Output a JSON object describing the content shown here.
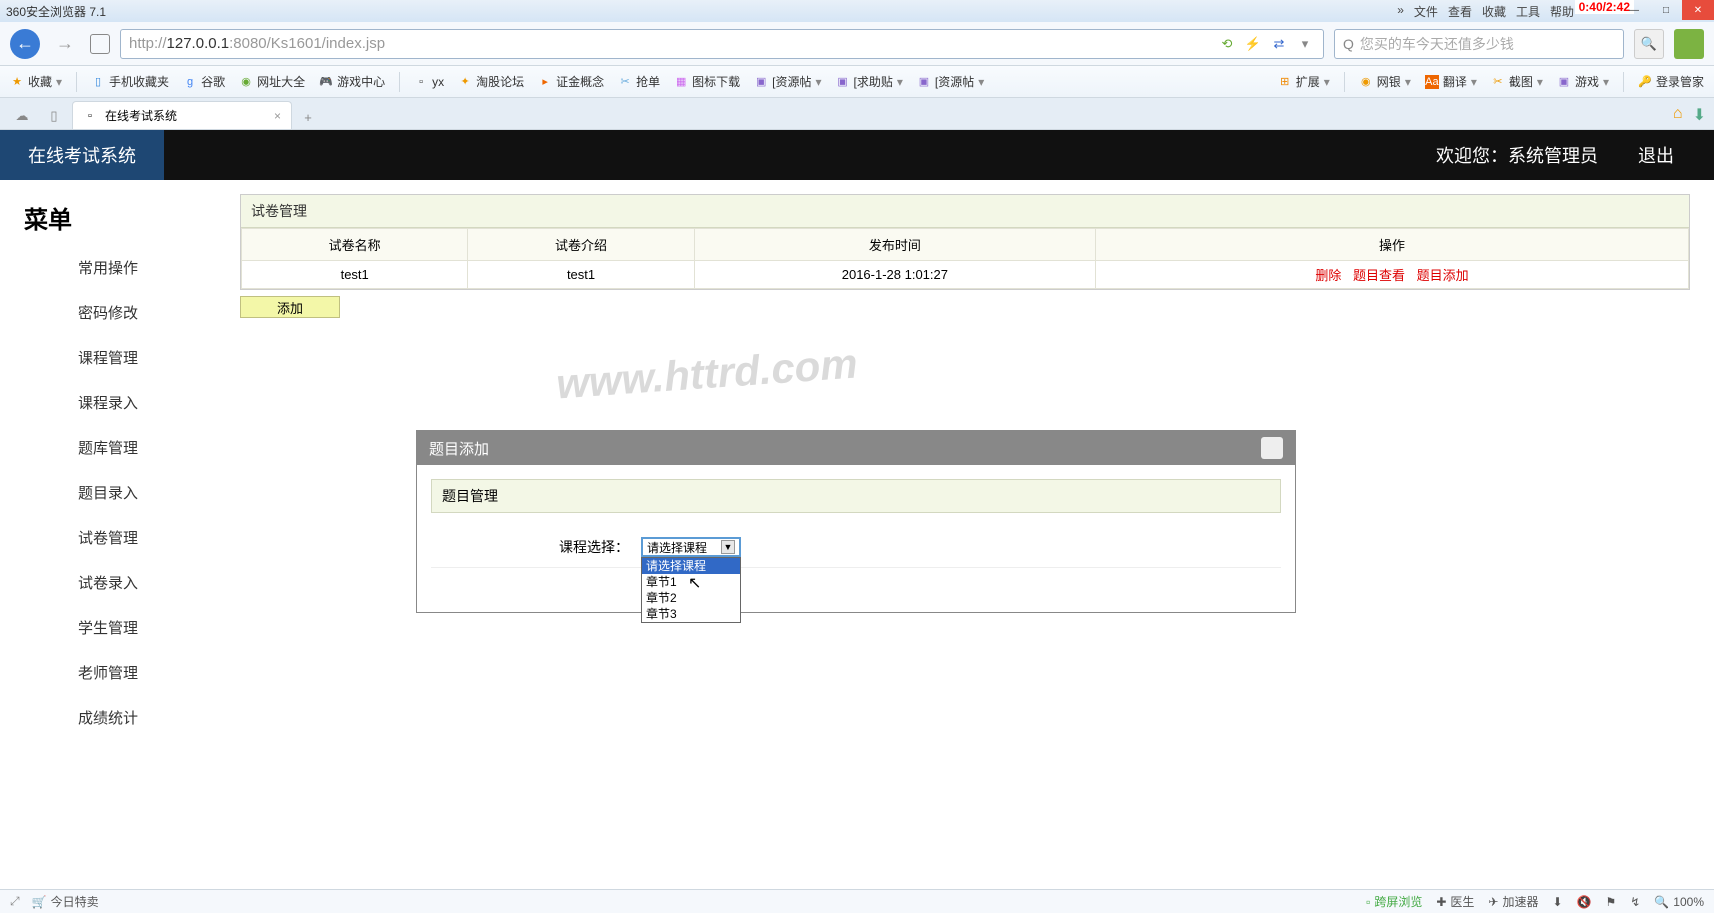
{
  "browser": {
    "title": "360安全浏览器 7.1",
    "menus": [
      "»",
      "文件",
      "查看",
      "收藏",
      "工具",
      "帮助"
    ],
    "time_overlay": "0:40/2:42",
    "url_display": {
      "proto": "http://",
      "host": "127.0.0.1",
      "port_path": ":8080/Ks1601/index.jsp"
    },
    "search_placeholder": "您买的车今天还值多少钱",
    "bookmarks": [
      "收藏",
      "手机收藏夹",
      "谷歌",
      "网址大全",
      "游戏中心",
      "yx",
      "淘股论坛",
      "证金概念",
      "抢单",
      "图标下载",
      "[资源帖",
      "[求助贴",
      "[资源帖"
    ],
    "bookmarks_right": [
      "扩展",
      "网银",
      "翻译",
      "截图",
      "游戏",
      "登录管家"
    ],
    "tab_title": "在线考试系统"
  },
  "page": {
    "header_title": "在线考试系统",
    "welcome": "欢迎您：系统管理员",
    "logout": "退出",
    "sidebar_title": "菜单",
    "menu_header": "常用操作",
    "menu_items": [
      "密码修改",
      "课程管理",
      "课程录入",
      "题库管理",
      "题目录入",
      "试卷管理",
      "试卷录入",
      "学生管理",
      "老师管理",
      "成绩统计"
    ],
    "panel_title": "试卷管理",
    "table": {
      "headers": [
        "试卷名称",
        "试卷介绍",
        "发布时间",
        "操作"
      ],
      "rows": [
        {
          "name": "test1",
          "intro": "test1",
          "time": "2016-1-28 1:01:27",
          "ops": [
            "删除",
            "题目查看",
            "题目添加"
          ]
        }
      ]
    },
    "add_button": "添加",
    "watermark": "www.httrd.com"
  },
  "dialog": {
    "title": "题目添加",
    "panel_title": "题目管理",
    "form_label": "课程选择：",
    "select_value": "请选择课程",
    "options": [
      "请选择课程",
      "章节1",
      "章节2",
      "章节3"
    ],
    "selected_index": 0
  },
  "statusbar": {
    "left": "今日特卖",
    "items": [
      "跨屏浏览",
      "医生",
      "加速器",
      "100%"
    ]
  }
}
